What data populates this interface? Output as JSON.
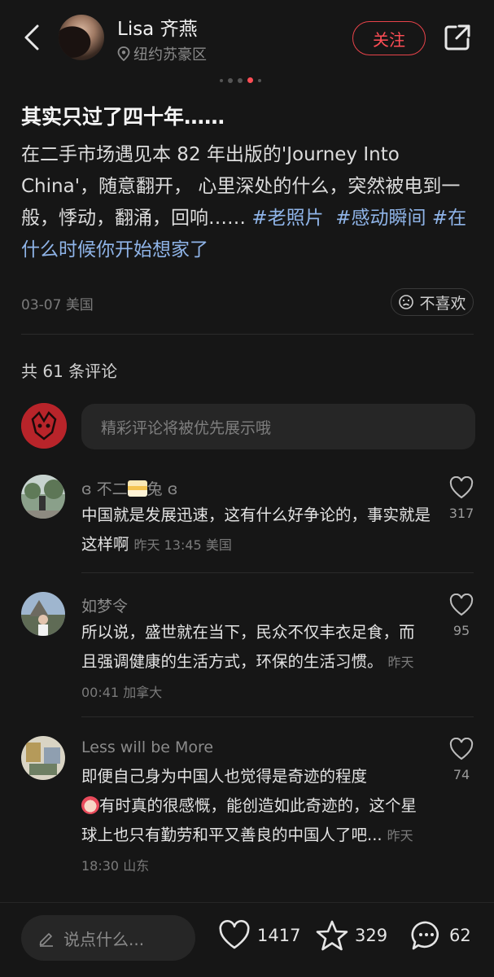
{
  "header": {
    "user_name": "Lisa 齐燕",
    "location": "纽约苏豪区",
    "follow_label": "关注"
  },
  "post": {
    "title": "其实只过了四十年……",
    "body_text": "在二手市场遇见本 82 年出版的'Journey Into China'，随意翻开， 心里深处的什么，突然被电到一般，悸动，翻涌，回响……",
    "tags": [
      "#老照片",
      "#感动瞬间",
      "#在什么时候你开始想家了"
    ],
    "date": "03-07",
    "region": "美国",
    "dislike_label": "不喜欢"
  },
  "comments_section": {
    "count_label": "共 61 条评论",
    "input_placeholder": "精彩评论将被优先展示哦"
  },
  "comments": [
    {
      "name_left": "ɞ 不二",
      "name_right": "兔 ɞ",
      "text": "中国就是发展迅速，这有什么好争论的，事实就是这样啊",
      "time": "昨天 13:45",
      "region": "美国",
      "likes": "317"
    },
    {
      "name": "如梦令",
      "text": "所以说，盛世就在当下，民众不仅丰衣足食，而且强调健康的生活方式，环保的生活习惯。",
      "time": "昨天 00:41",
      "region": "加拿大",
      "likes": "95"
    },
    {
      "name": "Less will be More",
      "text_line1": "即便自己身为中国人也觉得是奇迹的程度",
      "text_rest": "有时真的很感慨，能创造如此奇迹的，这个星球上也只有勤劳和平又善良的中国人了吧...",
      "time": "昨天 18:30",
      "region": "山东",
      "likes": "74"
    }
  ],
  "bottom_bar": {
    "say_placeholder": "说点什么...",
    "likes": "1417",
    "favorites": "329",
    "comments": "62"
  },
  "colors": {
    "background": "#161616",
    "accent": "#ff4d55",
    "tag": "#8fb4e8"
  }
}
